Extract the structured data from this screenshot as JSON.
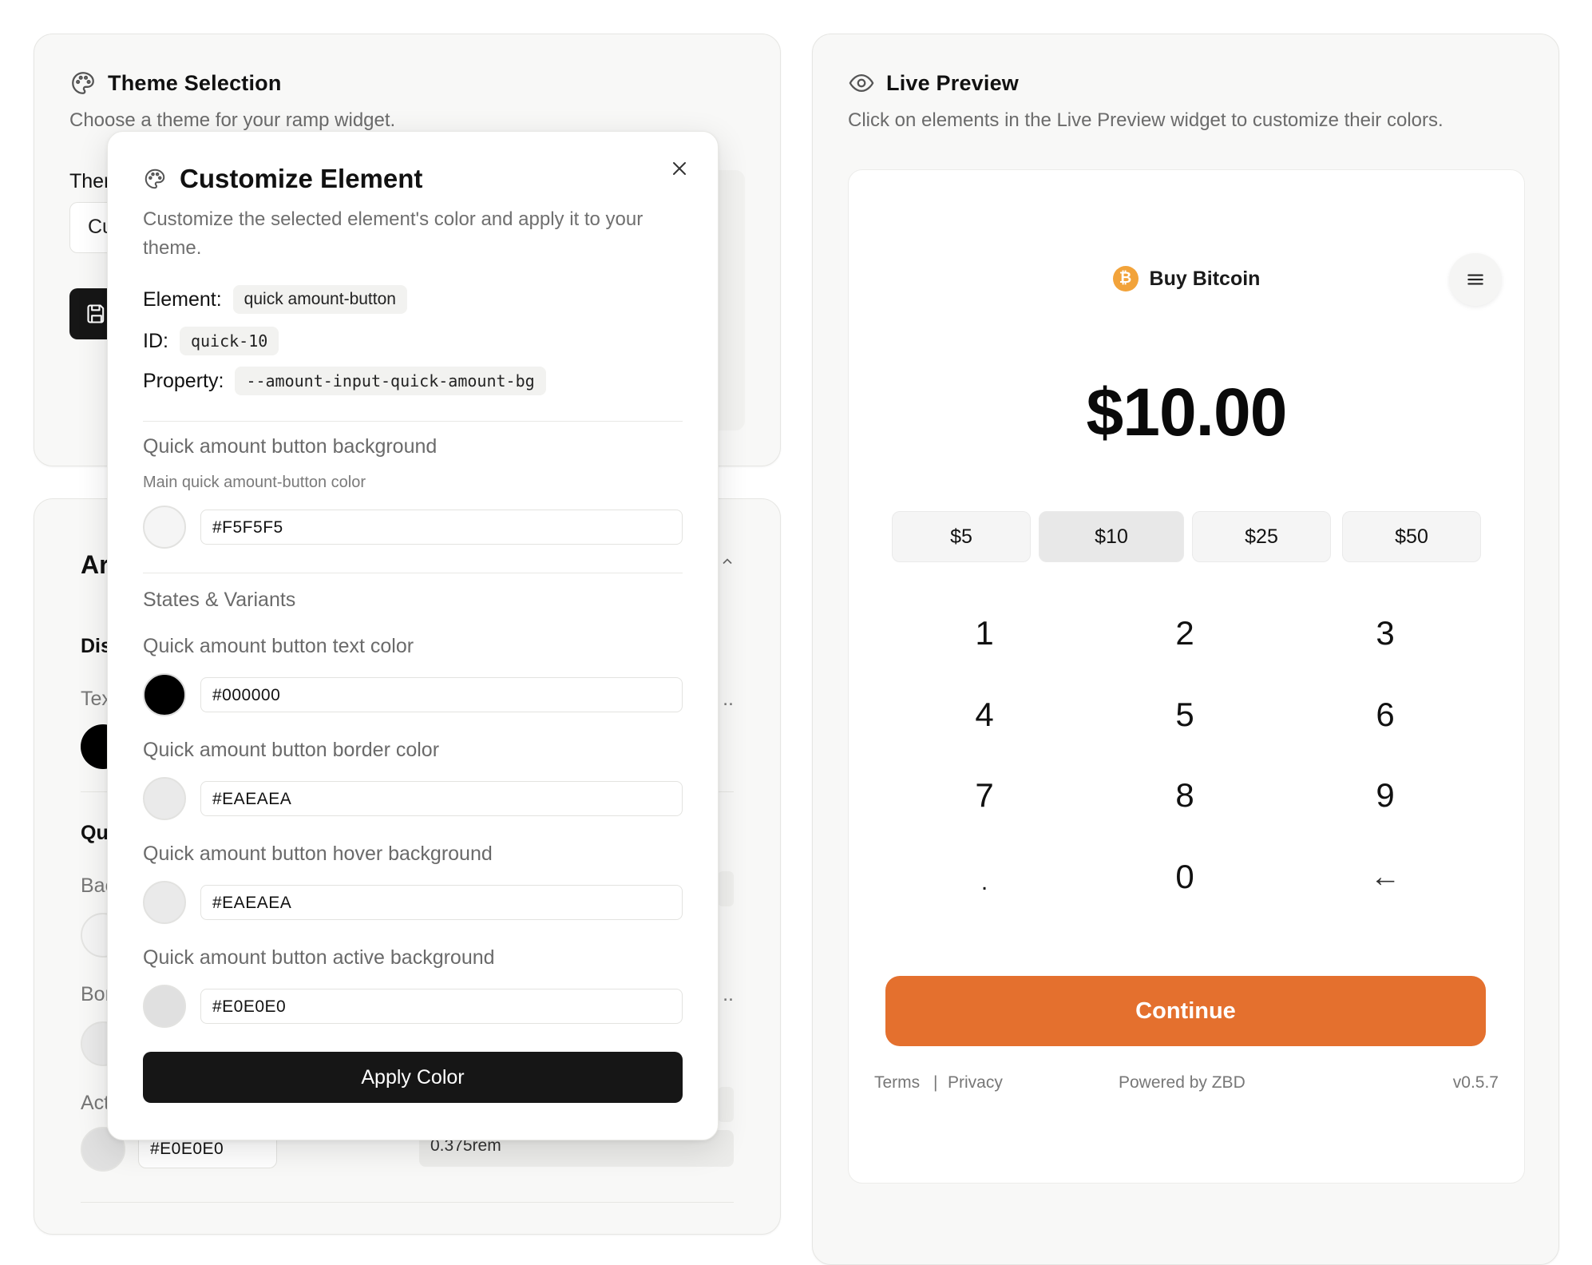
{
  "theme_card": {
    "title": "Theme Selection",
    "subtitle": "Choose a theme for your ramp widget.",
    "theme_label_partial": "Ther",
    "select_partial": "Cu"
  },
  "appearance_card": {
    "title_partial": "Ar",
    "display_partial": "Dis",
    "text_partial": "Tex",
    "quick_partial": "Qu",
    "background_partial": "Bac",
    "border_partial": "Bor",
    "active_partial": "Act",
    "active_hex": "#E0E0E0",
    "radius_value": "0.375rem",
    "ellipsis_1": "..",
    "ellipsis_2": ".."
  },
  "modal": {
    "title": "Customize Element",
    "description": "Customize the selected element's color and apply it to your theme.",
    "element_label": "Element:",
    "element_value": "quick amount-button",
    "id_label": "ID:",
    "id_value": "quick-10",
    "property_label": "Property:",
    "property_value": "--amount-input-quick-amount-bg",
    "main": {
      "label": "Quick amount button background",
      "hint": "Main quick amount-button color",
      "hex": "#F5F5F5"
    },
    "states_heading": "States & Variants",
    "variants": [
      {
        "label": "Quick amount button text color",
        "hex": "#000000"
      },
      {
        "label": "Quick amount button border color",
        "hex": "#EAEAEA"
      },
      {
        "label": "Quick amount button hover background",
        "hex": "#EAEAEA"
      },
      {
        "label": "Quick amount button active background",
        "hex": "#E0E0E0"
      }
    ],
    "apply_label": "Apply Color"
  },
  "preview_card": {
    "title": "Live Preview",
    "subtitle": "Click on elements in the Live Preview widget to customize their colors."
  },
  "widget": {
    "btc_symbol": "₿",
    "title": "Buy Bitcoin",
    "amount": "$10.00",
    "quick_amounts": [
      "$5",
      "$10",
      "$25",
      "$50"
    ],
    "keys": [
      "1",
      "2",
      "3",
      "4",
      "5",
      "6",
      "7",
      "8",
      "9",
      ".",
      "0",
      "←"
    ],
    "continue_label": "Continue",
    "terms": "Terms",
    "separator": "|",
    "privacy": "Privacy",
    "powered": "Powered by ZBD",
    "version": "v0.5.7"
  },
  "colors": {
    "accent": "#E4702E",
    "btc": "#F2A33A",
    "apply_bg": "#161616"
  }
}
